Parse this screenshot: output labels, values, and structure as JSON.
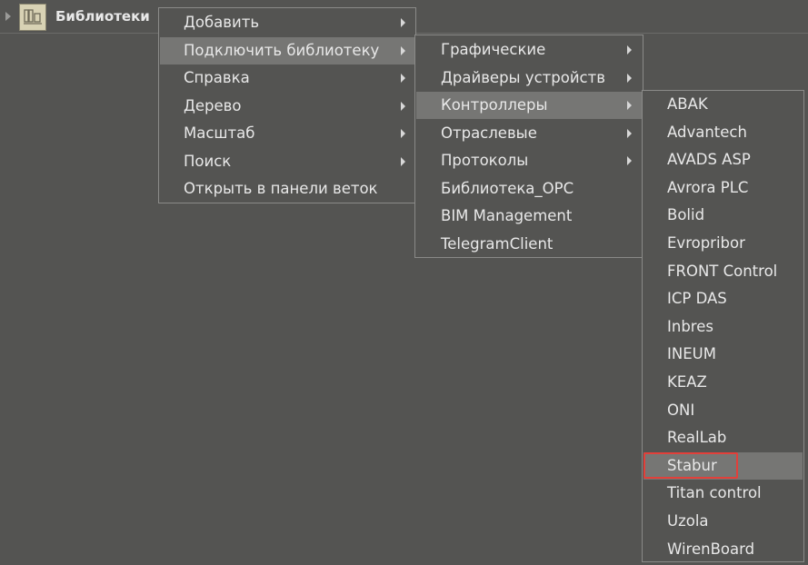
{
  "tree": {
    "label": "Библиотеки"
  },
  "menu1": {
    "items": [
      {
        "label": "Добавить",
        "submenu": true
      },
      {
        "label": "Подключить библиотеку",
        "submenu": true,
        "highlighted": true
      },
      {
        "label": "Справка",
        "submenu": true
      },
      {
        "label": "Дерево",
        "submenu": true
      },
      {
        "label": "Масштаб",
        "submenu": true
      },
      {
        "label": "Поиск",
        "submenu": true
      },
      {
        "label": "Открыть в панели веток",
        "submenu": false
      }
    ]
  },
  "menu2": {
    "items": [
      {
        "label": "Графические",
        "submenu": true
      },
      {
        "label": "Драйверы устройств",
        "submenu": true
      },
      {
        "label": "Контроллеры",
        "submenu": true,
        "highlighted": true
      },
      {
        "label": "Отраслевые",
        "submenu": true
      },
      {
        "label": "Протоколы",
        "submenu": true
      },
      {
        "label": "Библиотека_OPC",
        "submenu": false
      },
      {
        "label": "BIM Management",
        "submenu": false
      },
      {
        "label": "TelegramClient",
        "submenu": false
      }
    ]
  },
  "menu3": {
    "items": [
      {
        "label": "ABAK"
      },
      {
        "label": "Advantech"
      },
      {
        "label": "AVADS ASP"
      },
      {
        "label": "Avrora PLC"
      },
      {
        "label": "Bolid"
      },
      {
        "label": "Evropribor"
      },
      {
        "label": "FRONT Control"
      },
      {
        "label": "ICP DAS"
      },
      {
        "label": "Inbres"
      },
      {
        "label": "INEUM"
      },
      {
        "label": "KEAZ"
      },
      {
        "label": "ONI"
      },
      {
        "label": "RealLab"
      },
      {
        "label": "Stabur",
        "highlighted": true
      },
      {
        "label": "Titan control"
      },
      {
        "label": "Uzola"
      },
      {
        "label": "WirenBoard"
      }
    ]
  },
  "colors": {
    "background": "#545452",
    "highlight": "#767674",
    "focus_outline": "#e2403a",
    "icon_bg": "#d8d2b4"
  }
}
